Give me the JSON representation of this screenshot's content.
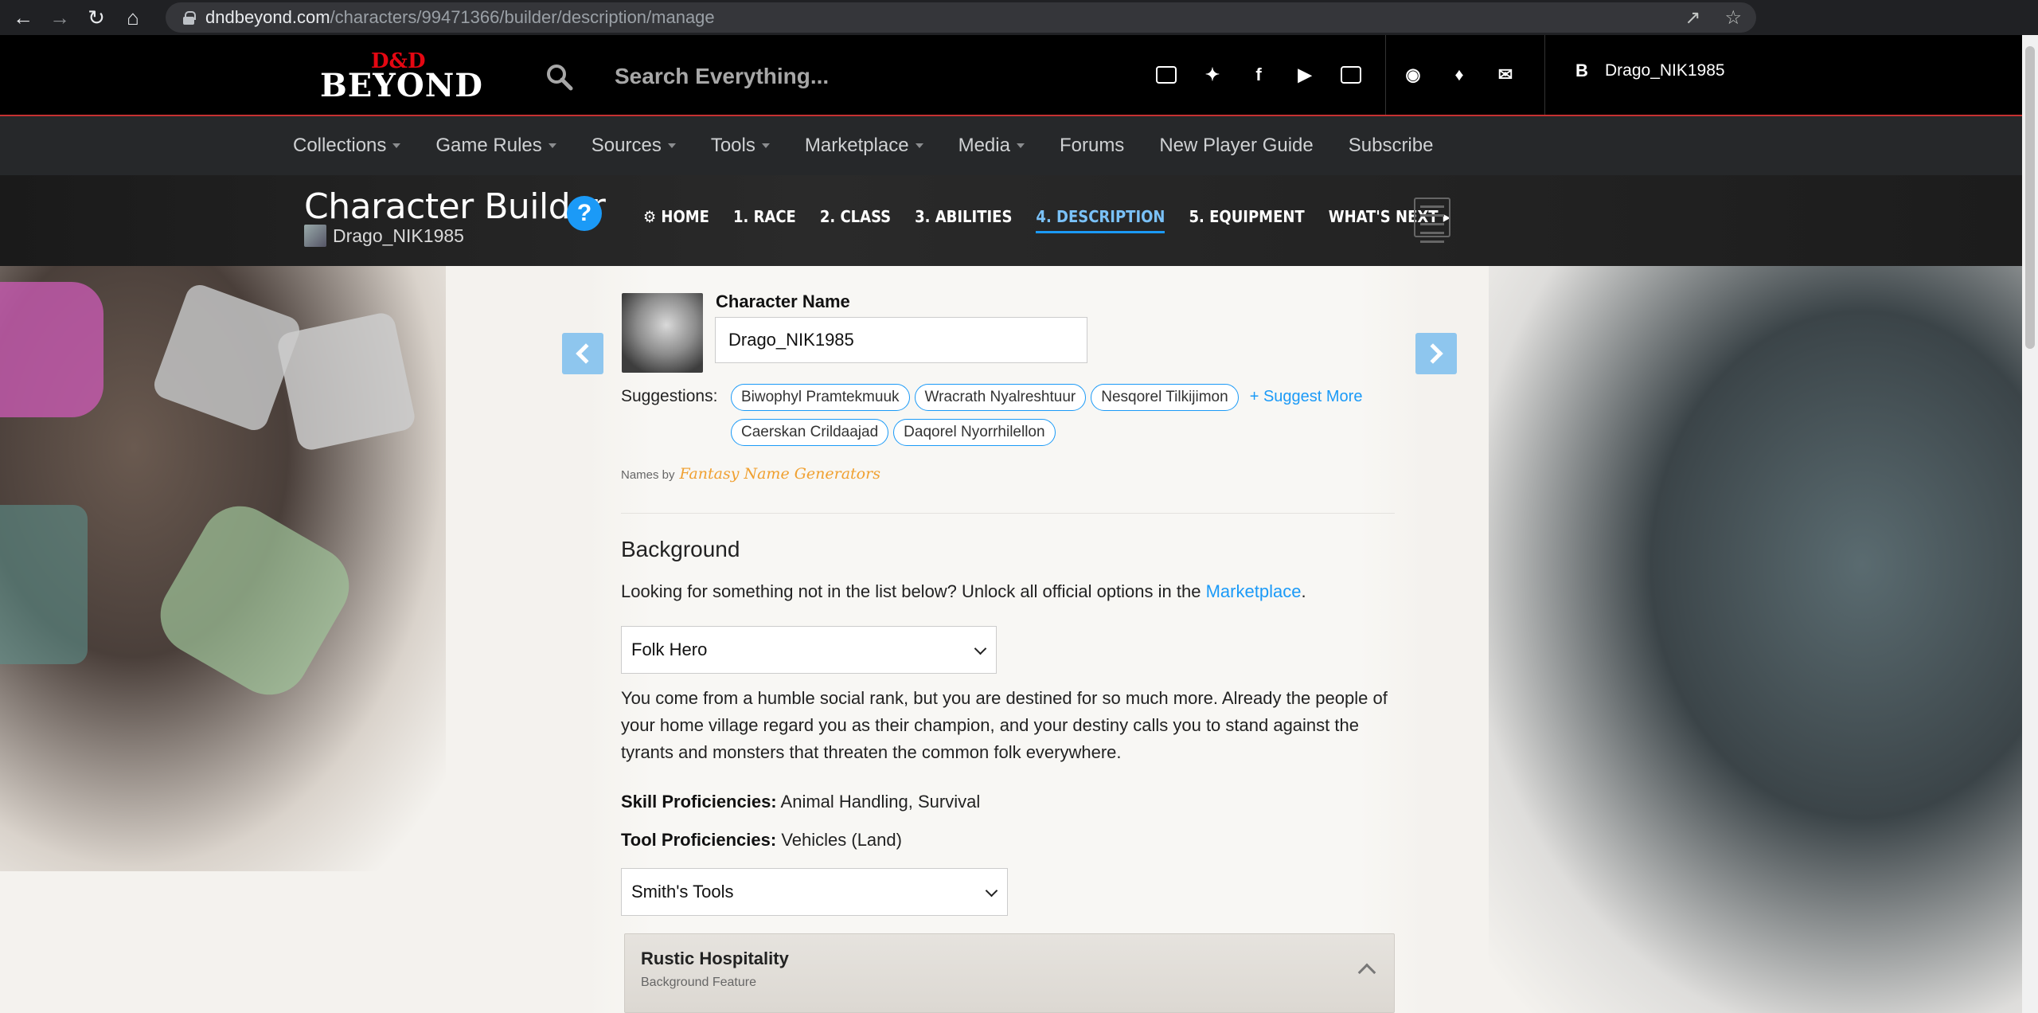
{
  "browser": {
    "url_domain": "dndbeyond.com",
    "url_path": "/characters/99471366/builder/description/manage"
  },
  "header": {
    "logo_top": "D&D",
    "logo_bottom": "BEYOND",
    "search_placeholder": "Search Everything...",
    "user_initial": "B",
    "username": "Drago_NIK1985"
  },
  "mainnav": {
    "items": [
      {
        "label": "Collections",
        "dropdown": true
      },
      {
        "label": "Game Rules",
        "dropdown": true
      },
      {
        "label": "Sources",
        "dropdown": true
      },
      {
        "label": "Tools",
        "dropdown": true
      },
      {
        "label": "Marketplace",
        "dropdown": true
      },
      {
        "label": "Media",
        "dropdown": true
      },
      {
        "label": "Forums",
        "dropdown": false
      },
      {
        "label": "New Player Guide",
        "dropdown": false
      },
      {
        "label": "Subscribe",
        "dropdown": false
      }
    ]
  },
  "builder": {
    "title": "Character Builder",
    "user": "Drago_NIK1985",
    "help": "?",
    "steps": [
      {
        "label": "⚙ HOME",
        "active": false
      },
      {
        "label": "1. RACE",
        "active": false
      },
      {
        "label": "2. CLASS",
        "active": false
      },
      {
        "label": "3. ABILITIES",
        "active": false
      },
      {
        "label": "4. DESCRIPTION",
        "active": true
      },
      {
        "label": "5. EQUIPMENT",
        "active": false
      },
      {
        "label": "WHAT'S NEXT ▸",
        "active": false
      }
    ]
  },
  "description": {
    "name_label": "Character Name",
    "name_value": "Drago_NIK1985",
    "suggestions_label": "Suggestions:",
    "suggestions": [
      "Biwophyl Pramtekmuuk",
      "Wracrath Nyalreshtuur",
      "Nesqorel Tilkijimon",
      "Caerskan Crildaajad",
      "Daqorel Nyorrhilellon"
    ],
    "suggest_more": "+ Suggest More",
    "names_by": "Names by",
    "names_by_source": "Fantasy Name Generators",
    "background_title": "Background",
    "unlock_text": "Looking for something not in the list below? Unlock all official options in the",
    "unlock_link": "Marketplace",
    "unlock_end": ".",
    "background_selected": "Folk Hero",
    "background_desc": "You come from a humble social rank, but you are destined for so much more. Already the people of your home village regard you as their champion, and your destiny calls you to stand against the tyrants and monsters that threaten the common folk everywhere.",
    "skill_label": "Skill Proficiencies:",
    "skill_value": "Animal Handling, Survival",
    "tool_label": "Tool Proficiencies:",
    "tool_value": "Vehicles (Land)",
    "tool_selected": "Smith's Tools",
    "feature_title": "Rustic Hospitality",
    "feature_subtitle": "Background Feature"
  }
}
